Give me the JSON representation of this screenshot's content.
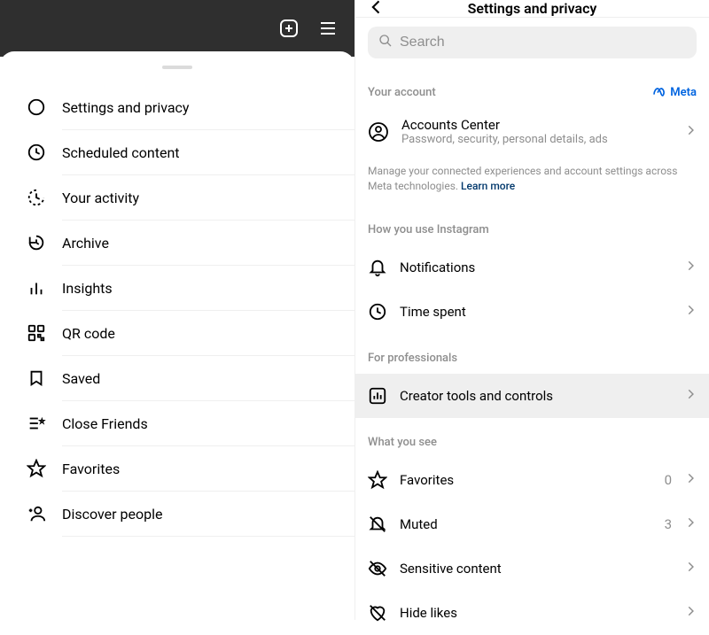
{
  "left_menu": {
    "items": [
      {
        "id": "settings-privacy",
        "label": "Settings and privacy",
        "icon": "gear-icon"
      },
      {
        "id": "scheduled-content",
        "label": "Scheduled content",
        "icon": "clock-icon"
      },
      {
        "id": "your-activity",
        "label": "Your activity",
        "icon": "activity-icon"
      },
      {
        "id": "archive",
        "label": "Archive",
        "icon": "archive-icon"
      },
      {
        "id": "insights",
        "label": "Insights",
        "icon": "insights-icon"
      },
      {
        "id": "qr-code",
        "label": "QR code",
        "icon": "qrcode-icon"
      },
      {
        "id": "saved",
        "label": "Saved",
        "icon": "bookmark-icon"
      },
      {
        "id": "close-friends",
        "label": "Close Friends",
        "icon": "closefriends-icon"
      },
      {
        "id": "favorites",
        "label": "Favorites",
        "icon": "star-icon"
      },
      {
        "id": "discover-people",
        "label": "Discover people",
        "icon": "adduser-icon"
      }
    ]
  },
  "right_panel": {
    "header_title": "Settings and privacy",
    "search_placeholder": "Search",
    "sections": {
      "your_account": {
        "title": "Your account",
        "meta_label": "Meta",
        "accounts_center": {
          "title": "Accounts Center",
          "subtitle": "Password, security, personal details, ads"
        },
        "info_text": "Manage your connected experiences and account settings across Meta technologies. ",
        "learn_more": "Learn more"
      },
      "how_you_use": {
        "title": "How you use Instagram",
        "rows": [
          {
            "id": "notifications",
            "label": "Notifications",
            "icon": "bell-icon"
          },
          {
            "id": "time-spent",
            "label": "Time spent",
            "icon": "clock-icon"
          }
        ]
      },
      "for_professionals": {
        "title": "For professionals",
        "rows": [
          {
            "id": "creator-tools",
            "label": "Creator tools and controls",
            "icon": "creatortools-icon",
            "highlighted": true
          }
        ]
      },
      "what_you_see": {
        "title": "What you see",
        "rows": [
          {
            "id": "favorites",
            "label": "Favorites",
            "icon": "star-icon",
            "value": "0"
          },
          {
            "id": "muted",
            "label": "Muted",
            "icon": "bellmute-icon",
            "value": "3"
          },
          {
            "id": "sensitive-content",
            "label": "Sensitive content",
            "icon": "eyeslash-icon"
          },
          {
            "id": "hide-likes",
            "label": "Hide likes",
            "icon": "heartslash-icon"
          }
        ]
      }
    }
  }
}
